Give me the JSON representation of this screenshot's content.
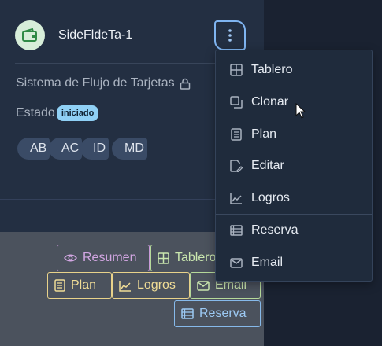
{
  "card": {
    "title": "SideFldeTa-1",
    "system_label": "Sistema de Flujo de Tarjetas",
    "estado_label": "Estado",
    "status": "iniciado",
    "avatars": [
      "AB",
      "AC",
      "ID",
      "MD"
    ]
  },
  "chips": {
    "resumen": "Resumen",
    "tablero": "Tablero",
    "plan": "Plan",
    "logros": "Logros",
    "email": "Email",
    "reserva": "Reserva"
  },
  "menu": {
    "items": [
      {
        "label": "Tablero",
        "icon": "table-icon"
      },
      {
        "label": "Clonar",
        "icon": "copy-icon"
      },
      {
        "label": "Plan",
        "icon": "document-icon"
      },
      {
        "label": "Editar",
        "icon": "edit-icon"
      },
      {
        "label": "Logros",
        "icon": "chart-line-icon"
      },
      {
        "label": "Reserva",
        "icon": "list-icon"
      },
      {
        "label": "Email",
        "icon": "mail-icon"
      }
    ]
  },
  "colors": {
    "background": "#1a2231",
    "card": "#232f42",
    "menu": "#1f2b3c",
    "status_badge": "#8fd0f5",
    "kebab_border": "#7fb4f0"
  }
}
